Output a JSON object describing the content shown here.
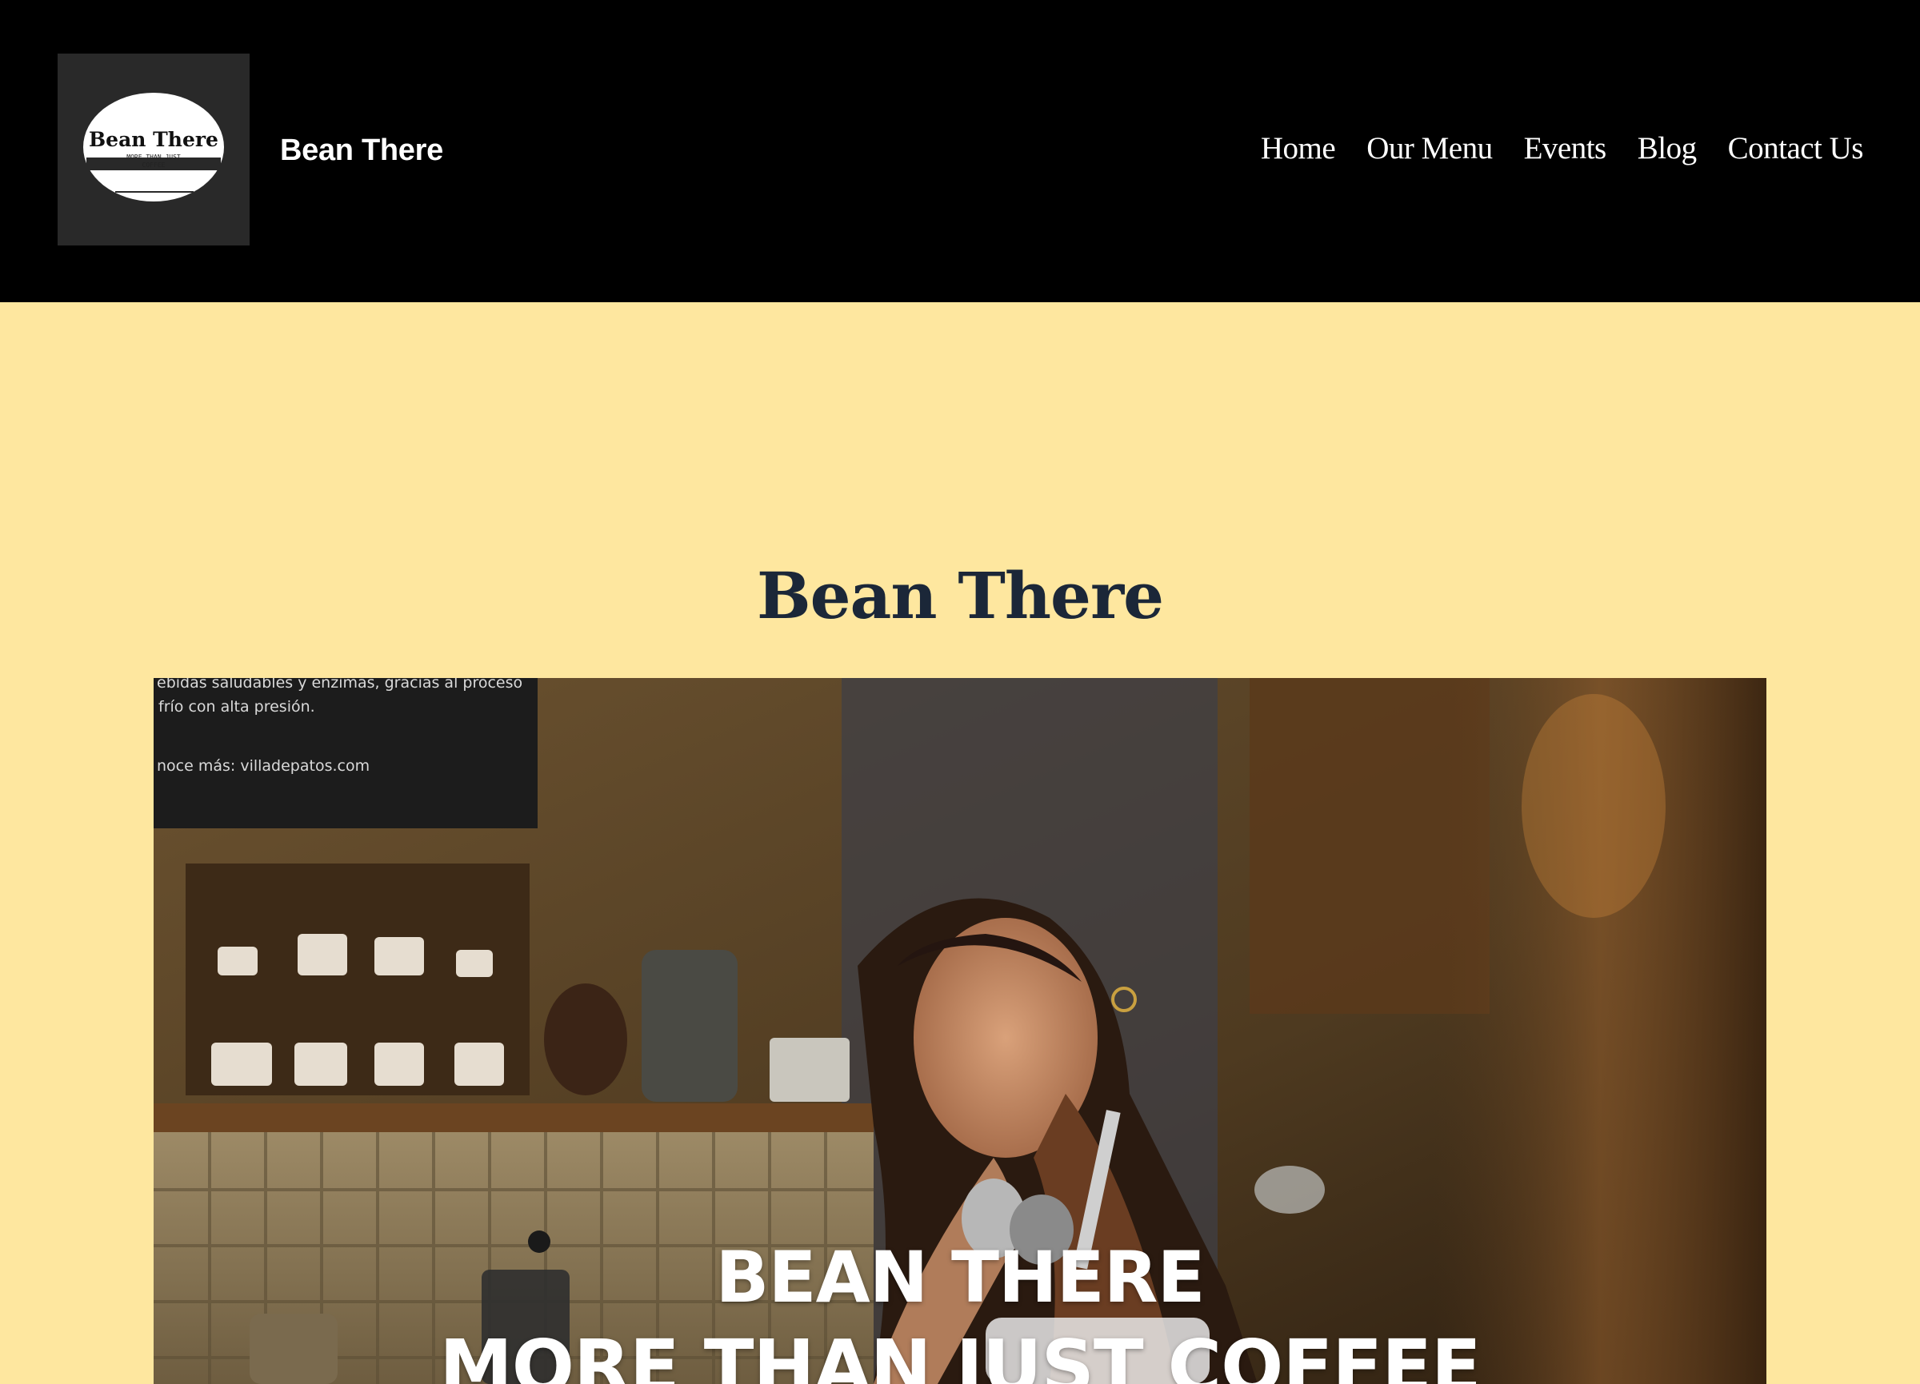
{
  "header": {
    "logo": {
      "title": "Bean There",
      "tagline_line1": "MORE THAN JUST",
      "tagline_line2": "COFFEE"
    },
    "site_title": "Bean There",
    "nav": [
      {
        "label": "Home"
      },
      {
        "label": "Our Menu"
      },
      {
        "label": "Events"
      },
      {
        "label": "Blog"
      },
      {
        "label": "Contact Us"
      }
    ]
  },
  "main": {
    "heading": "Bean There",
    "hero_video": {
      "sign_line1": "ebidas saludables y enzimas, gracias al proceso",
      "sign_line2": "frío con alta presión.",
      "sign_line3": "noce más: villadepatos.com",
      "overlay_line1": "BEAN THERE",
      "overlay_line2": "MORE THAN JUST COFFEE"
    }
  },
  "colors": {
    "header_bg": "#000000",
    "logo_bg": "#292929",
    "page_bg": "#fee79f",
    "heading_text": "#1b2738",
    "nav_text": "#ffffff"
  }
}
